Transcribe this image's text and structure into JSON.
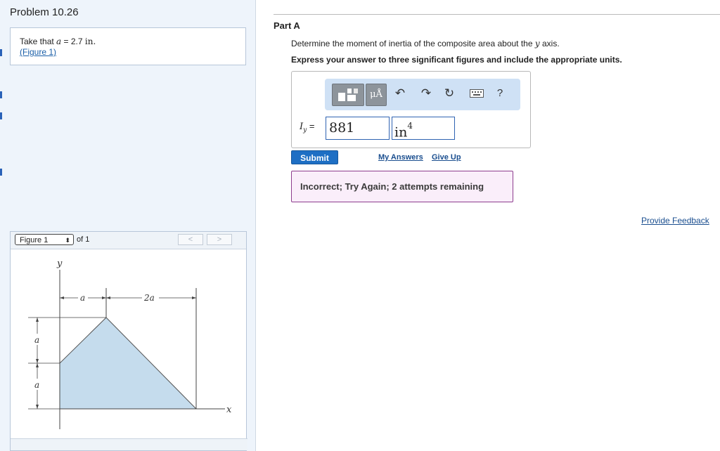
{
  "problem": {
    "title": "Problem 10.26",
    "given_prefix": "Take that ",
    "given_var": "a",
    "given_eq": " = 2.7 ",
    "given_unit": "in.",
    "figure_link": "(Figure 1)"
  },
  "figure_panel": {
    "select_value": "Figure 1",
    "of_label": "of 1",
    "prev_label": "<",
    "next_label": ">",
    "labels": {
      "y_axis": "y",
      "x_axis": "x",
      "dim_a_top": "a",
      "dim_2a_top": "2a",
      "dim_a_upper_left": "a",
      "dim_a_lower_left": "a"
    },
    "fill_color": "#c5dced"
  },
  "part": {
    "title": "Part A",
    "question_prefix": "Determine the moment of inertia of the composite area about the ",
    "question_var": "y",
    "question_suffix": " axis.",
    "instruction": "Express your answer to three significant figures and include the appropriate units."
  },
  "toolbar": {
    "units_label": "μÅ",
    "undo_icon": "undo-icon",
    "redo_icon": "redo-icon",
    "reset_icon": "reset-icon",
    "keyboard_icon": "keyboard-icon",
    "help_label": "?"
  },
  "answer": {
    "label_var": "I",
    "label_sub": "y",
    "label_eq": " =",
    "value": "881",
    "unit": "in",
    "unit_exp": "4"
  },
  "actions": {
    "submit": "Submit",
    "my_answers": "My Answers",
    "give_up": "Give Up"
  },
  "feedback": {
    "message": "Incorrect; Try Again; 2 attempts remaining"
  },
  "provide_feedback": "Provide Feedback",
  "colors": {
    "accent": "#1e6fc4",
    "feedback_border": "#8d3d8e",
    "feedback_bg": "#faeefa"
  }
}
